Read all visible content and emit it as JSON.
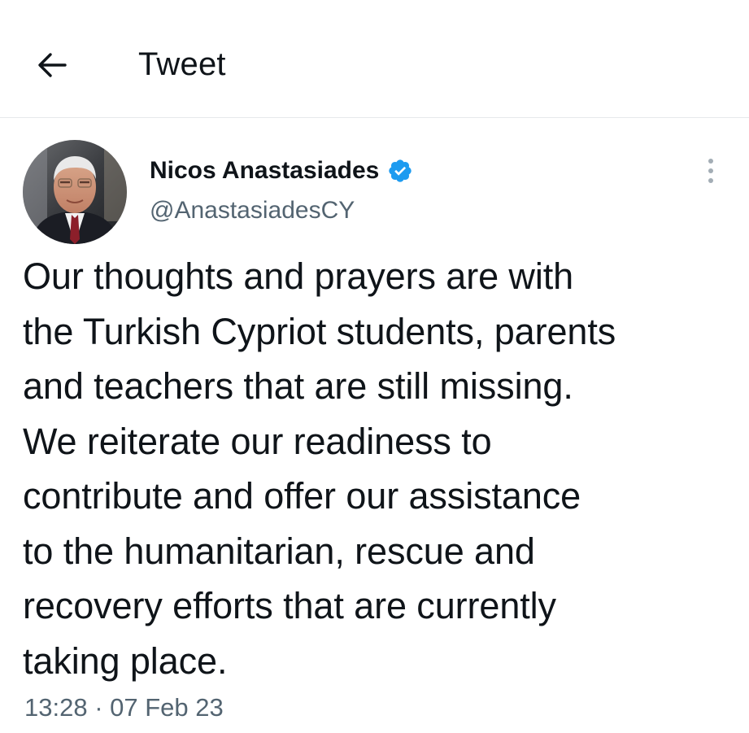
{
  "header": {
    "title": "Tweet",
    "back_icon": "arrow-left-icon"
  },
  "tweet": {
    "author": {
      "name": "Nicos Anastasiades",
      "handle": "@AnastasiadesCY",
      "verified": true,
      "verified_color": "#1d9bf0"
    },
    "text": "Our thoughts and prayers are with\nthe Turkish Cypriot students, parents\nand teachers that are still missing.\nWe reiterate our readiness to\ncontribute and offer our assistance\nto the humanitarian, rescue and\nrecovery efforts that are currently\ntaking place.",
    "time": "13:28",
    "separator": "·",
    "date": "07 Feb 23",
    "more_icon": "more-vertical-icon"
  }
}
